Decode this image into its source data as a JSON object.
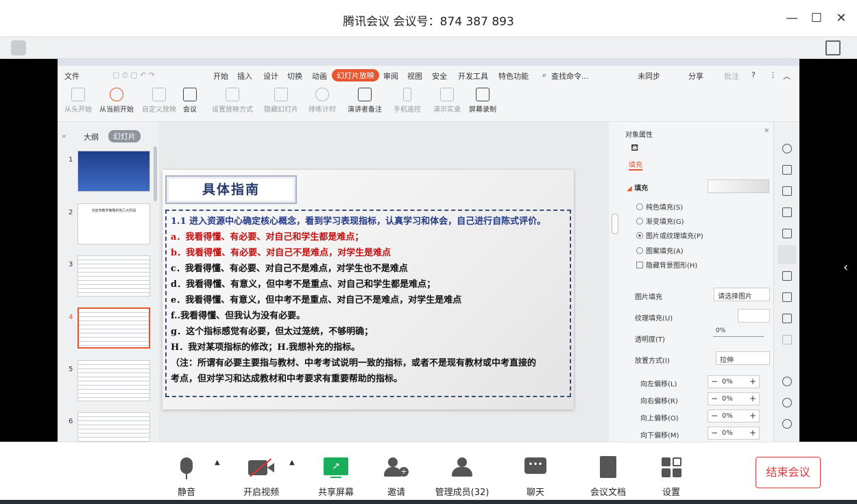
{
  "window": {
    "title": "腾讯会议 会议号：874 387 893"
  },
  "wps": {
    "menu": [
      "文件",
      "开始",
      "插入",
      "设计",
      "切换",
      "动画",
      "幻灯片放映",
      "审阅",
      "视图",
      "安全",
      "开发工具",
      "特色功能",
      "查找命令..."
    ],
    "menu_active": "幻灯片放映",
    "sync": "未同步",
    "share": "分享",
    "comment": "批注",
    "ribbon": [
      {
        "label": "从头开始",
        "enabled": false
      },
      {
        "label": "从当前开始",
        "enabled": true
      },
      {
        "label": "自定义放映",
        "enabled": false
      },
      {
        "label": "会议",
        "enabled": true
      },
      {
        "label": "设置放映方式",
        "enabled": false
      },
      {
        "label": "隐藏幻灯片",
        "enabled": false
      },
      {
        "label": "排练计时",
        "enabled": false
      },
      {
        "label": "演讲者备注",
        "enabled": true
      },
      {
        "label": "手机遥控",
        "enabled": false
      },
      {
        "label": "演示实录",
        "enabled": false
      },
      {
        "label": "屏幕录制",
        "enabled": true
      }
    ],
    "left_tabs": {
      "outline": "大纲",
      "slides": "幻灯片"
    },
    "thumbnails": [
      "1",
      "2",
      "3",
      "4",
      "5",
      "6"
    ],
    "selected_slide": "4",
    "thumb_slide2_title": "当前传教学策略的地几大阶段",
    "slide": {
      "title": "具体指南",
      "lines": [
        "1.1 进入资源中心确定核心概念，看到学习表现指标，认真学习和体会，自己进行自陈式评价。",
        "a．我看得懂、有必要、对自己和学生都是难点；",
        "b．我看得懂、有必要、对自己不是难点，对学生是难点",
        "c．我看得懂、有必要、对自己不是难点，对学生也不是难点",
        "d．我看得懂、有意义，但中考不是重点、对自己和学生都是难点；",
        "e．我看得懂、有意义，但中考不是重点、对自己不是难点，对学生是难点",
        "f..我看得懂、但我认为没有必要。",
        "g．这个指标感觉有必要，但太过笼统，不够明确；",
        "H．我对某项指标的修改；H.我想补充的指标。",
        "（注：所谓有必要主要指与教材、中考考试说明一致的指标，或者不是现有教材或中考直接的",
        "考点，但对学习和达成教材和中考要求有重要帮助的指标。"
      ]
    },
    "props": {
      "header": "对象属性",
      "tab": "填充",
      "section": "填充",
      "options": [
        "纯色填充(S)",
        "渐变填充(G)",
        "图片或纹理填充(P)",
        "图案填充(A)"
      ],
      "selected_option": "图片或纹理填充(P)",
      "hide_bg": "隐藏背景图形(H)",
      "picture_fill_label": "图片填充",
      "picture_fill_value": "请选择图片",
      "texture_fill_label": "纹理填充(U)",
      "transparency_label": "透明度(T)",
      "transparency_value": "0%",
      "placement_label": "放置方式(I)",
      "placement_value": "拉伸",
      "offsets": [
        {
          "label": "向左偏移(L)",
          "value": "0%"
        },
        {
          "label": "向右偏移(R)",
          "value": "0%"
        },
        {
          "label": "向上偏移(O)",
          "value": "0%"
        },
        {
          "label": "向下偏移(M)",
          "value": "0%"
        }
      ]
    }
  },
  "toolbar": {
    "mute": "静音",
    "video": "开启视频",
    "share_screen": "共享屏幕",
    "invite": "邀请",
    "members": "管理成员(32)",
    "chat": "聊天",
    "docs": "会议文档",
    "settings": "设置",
    "end": "结束会议"
  },
  "colors": {
    "accent": "#e7552e",
    "share_green": "#1aad5b",
    "end_red": "#d9363e"
  }
}
